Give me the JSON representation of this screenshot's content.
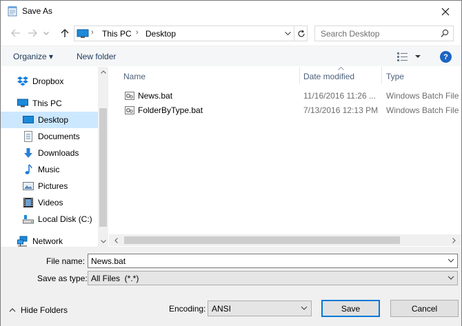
{
  "window": {
    "title": "Save As"
  },
  "addressbar": {
    "segments": [
      "This PC",
      "Desktop"
    ]
  },
  "search": {
    "placeholder": "Search Desktop"
  },
  "toolbar": {
    "organize_label": "Organize ▾",
    "newfolder_label": "New folder",
    "help_label": "?"
  },
  "sidebar": {
    "items": [
      {
        "label": "Dropbox",
        "icon": "dropbox-icon",
        "level": 0
      },
      {
        "label": "This PC",
        "icon": "computer-icon",
        "level": 0
      },
      {
        "label": "Desktop",
        "icon": "desktop-icon",
        "level": 1,
        "selected": true
      },
      {
        "label": "Documents",
        "icon": "documents-icon",
        "level": 1
      },
      {
        "label": "Downloads",
        "icon": "downloads-icon",
        "level": 1
      },
      {
        "label": "Music",
        "icon": "music-icon",
        "level": 1
      },
      {
        "label": "Pictures",
        "icon": "pictures-icon",
        "level": 1
      },
      {
        "label": "Videos",
        "icon": "videos-icon",
        "level": 1
      },
      {
        "label": "Local Disk (C:)",
        "icon": "drive-icon",
        "level": 1
      },
      {
        "label": "Network",
        "icon": "network-icon",
        "level": 0
      }
    ]
  },
  "filelist": {
    "columns": [
      "Name",
      "Date modified",
      "Type"
    ],
    "rows": [
      {
        "name": "News.bat",
        "date": "11/16/2016 11:26 ...",
        "type": "Windows Batch File"
      },
      {
        "name": "FolderByType.bat",
        "date": "7/13/2016 12:13 PM",
        "type": "Windows Batch File"
      }
    ]
  },
  "form": {
    "filename_label": "File name:",
    "filename_value": "News.bat",
    "savetype_label": "Save as type:",
    "savetype_value": "All Files  (*.*)",
    "encoding_label": "Encoding:",
    "encoding_value": "ANSI",
    "hide_folders_label": "Hide Folders",
    "save_label": "Save",
    "cancel_label": "Cancel"
  },
  "colors": {
    "accent": "#0078d7",
    "selected_bg": "#cce8ff",
    "toolbar_text": "#1e395b"
  }
}
